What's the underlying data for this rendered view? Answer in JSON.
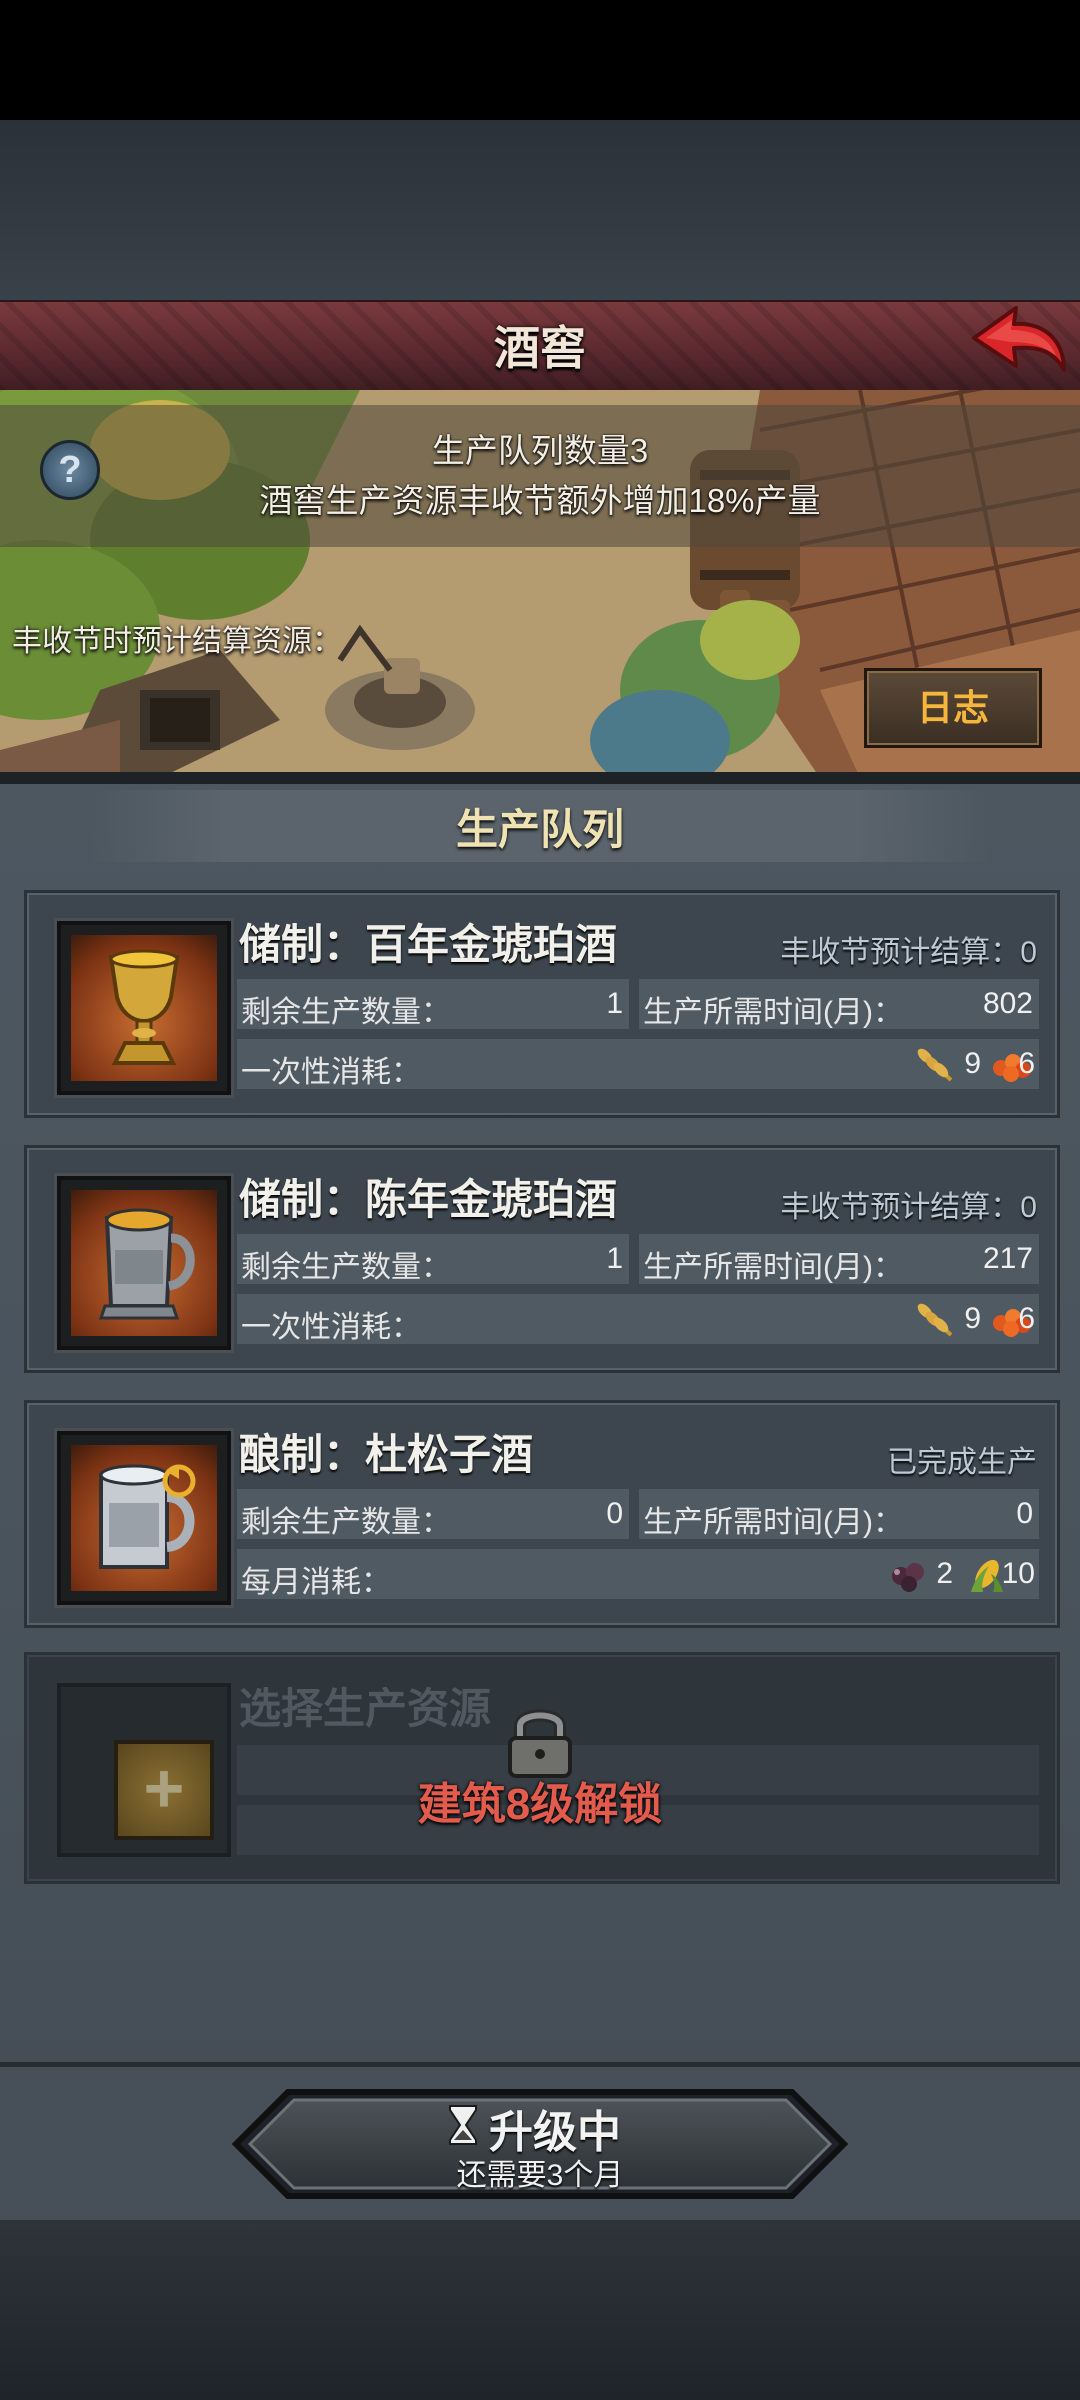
{
  "title": "酒窖",
  "info": {
    "queue_count": "生产队列数量3",
    "bonus": "酒窖生产资源丰收节额外增加18%产量",
    "harvest_label": "丰收节时预计结算资源：",
    "help_symbol": "?",
    "log_button": "日志"
  },
  "queue_title": "生产队列",
  "labels": {
    "remaining": "剩余生产数量：",
    "time": "生产所需时间(月)：",
    "once": "一次性消耗：",
    "monthly": "每月消耗："
  },
  "items": [
    {
      "name": "储制：百年金琥珀酒",
      "harvest": "丰收节预计结算：0",
      "remaining": "1",
      "time": "802",
      "res1_icon": "wheat-icon",
      "res1_value": "9",
      "res2_icon": "berry-icon",
      "res2_value": "6"
    },
    {
      "name": "储制：陈年金琥珀酒",
      "harvest": "丰收节预计结算：0",
      "remaining": "1",
      "time": "217",
      "res1_icon": "wheat-icon",
      "res1_value": "9",
      "res2_icon": "berry-icon",
      "res2_value": "6"
    },
    {
      "name": "酿制：杜松子酒",
      "harvest": "已完成生产",
      "remaining": "0",
      "time": "0",
      "res1_icon": "grape-icon",
      "res1_value": "2",
      "res2_icon": "corn-icon",
      "res2_value": "10"
    }
  ],
  "locked_slot": {
    "select_label": "选择生产资源",
    "plus_symbol": "+",
    "unlock_text": "建筑8级解锁"
  },
  "upgrade": {
    "label": "升级中",
    "sub": "还需要3个月"
  },
  "colors": {
    "title_bar": "#5c2a2f",
    "accent_gold": "#f6b63b",
    "unlock_red": "#e25b4d",
    "panel": "#4e5963"
  }
}
